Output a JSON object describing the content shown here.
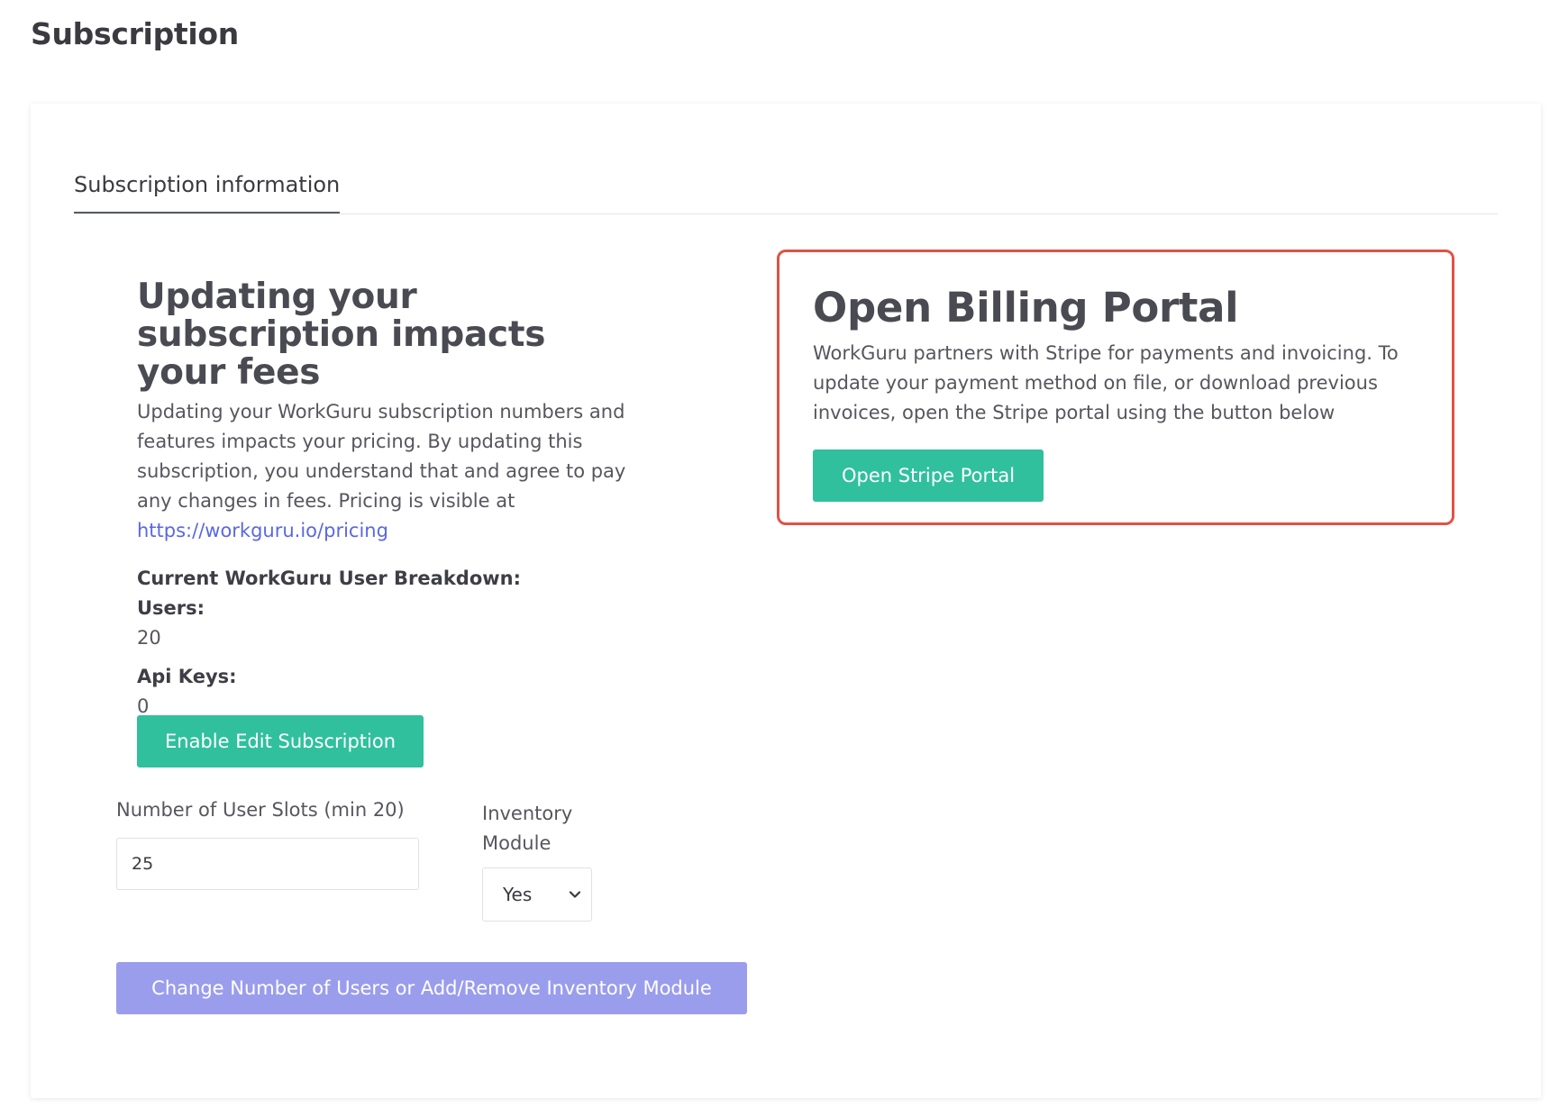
{
  "page": {
    "title": "Subscription"
  },
  "tabs": [
    {
      "label": "Subscription information",
      "active": true
    }
  ],
  "fees": {
    "heading": "Updating your subscription impacts your fees",
    "body": "Updating your WorkGuru subscription numbers and features impacts your pricing. By updating this subscription, you understand that and agree to pay any changes in fees. Pricing is visible at",
    "link": "https://workguru.io/pricing"
  },
  "breakdown": {
    "title": "Current WorkGuru User Breakdown:",
    "users_label": "Users:",
    "users_value": "20",
    "api_label": "Api Keys:",
    "api_value": "0"
  },
  "actions": {
    "enable_edit_label": "Enable Edit Subscription",
    "change_label": "Change Number of Users or Add/Remove Inventory Module"
  },
  "form": {
    "user_slots_label": "Number of User Slots (min 20)",
    "user_slots_value": "25",
    "inventory_label": "Inventory Module",
    "inventory_value": "Yes"
  },
  "billing": {
    "heading": "Open Billing Portal",
    "body": "WorkGuru partners with Stripe for payments and invoicing. To update your payment method on file, or download previous invoices, open the Stripe portal using the button below",
    "button_label": "Open Stripe Portal"
  },
  "colors": {
    "primary_green": "#30c09d",
    "disabled_purple": "#9a9deb",
    "highlight_red": "#e05246",
    "link_blue": "#5a68e0"
  }
}
